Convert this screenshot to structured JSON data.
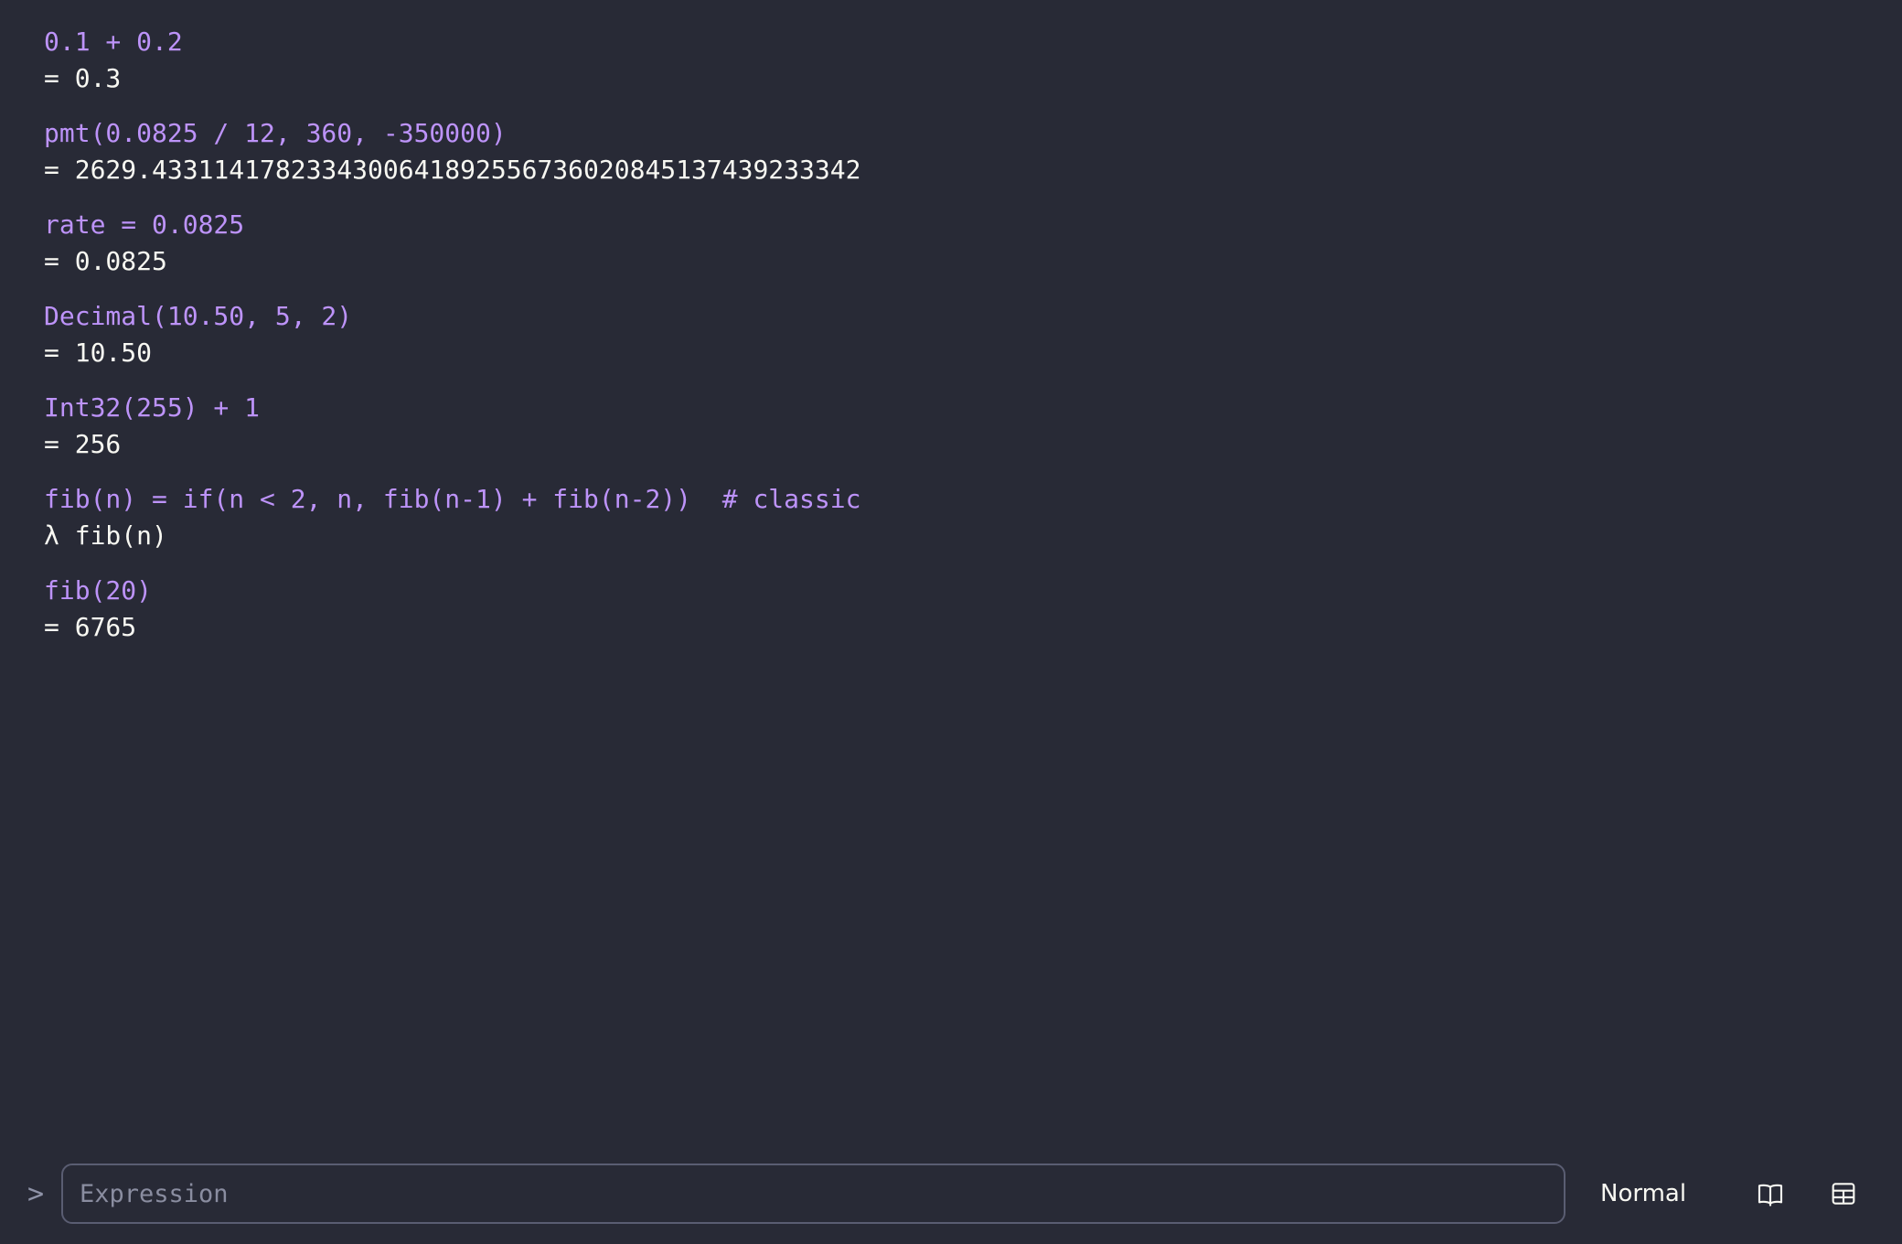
{
  "history": [
    {
      "expr": "0.1 + 0.2",
      "result": "= 0.3"
    },
    {
      "expr": "pmt(0.0825 / 12, 360, -350000)",
      "result": "= 2629.4331141782334300641892556736020845137439233342"
    },
    {
      "expr": "rate = 0.0825",
      "result": "= 0.0825"
    },
    {
      "expr": "Decimal(10.50, 5, 2)",
      "result": "= 10.50"
    },
    {
      "expr": "Int32(255) + 1",
      "result": "= 256"
    },
    {
      "expr": "fib(n) = if(n < 2, n, fib(n-1) + fib(n-2))  # classic",
      "result": "λ fib(n)"
    },
    {
      "expr": "fib(20)",
      "result": "= 6765"
    }
  ],
  "input": {
    "prompt": ">",
    "placeholder": "Expression",
    "value": ""
  },
  "toolbar": {
    "mode_label": "Normal",
    "docs_icon": "book-icon",
    "table_icon": "table-icon"
  },
  "colors": {
    "background": "#282a36",
    "expression": "#bd93f9",
    "result": "#f8f8f2",
    "border": "#5a5d72"
  }
}
